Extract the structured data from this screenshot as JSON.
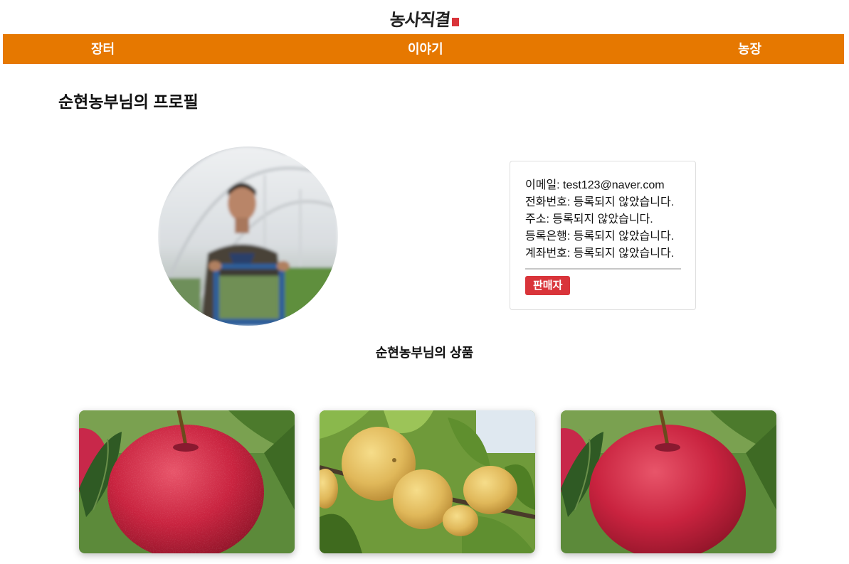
{
  "logo": {
    "text": "농사직결"
  },
  "nav": {
    "items": [
      "장터",
      "이야기",
      "농장"
    ]
  },
  "profile": {
    "title": "순현농부님의 프로필",
    "email": "이메일: test123@naver.com",
    "phone": "전화번호: 등록되지 않았습니다.",
    "address": "주소: 등록되지 않았습니다.",
    "bank": "등록은행: 등록되지 않았습니다.",
    "account": "계좌번호: 등록되지 않았습니다.",
    "role_badge": "판매자"
  },
  "products": {
    "title": "순현농부님의 상품",
    "items": [
      {
        "image": "apple-photo"
      },
      {
        "image": "pear-photo"
      },
      {
        "image": "apple-photo"
      }
    ]
  },
  "colors": {
    "nav_bg": "#e67800",
    "badge_bg": "#d9343a"
  }
}
